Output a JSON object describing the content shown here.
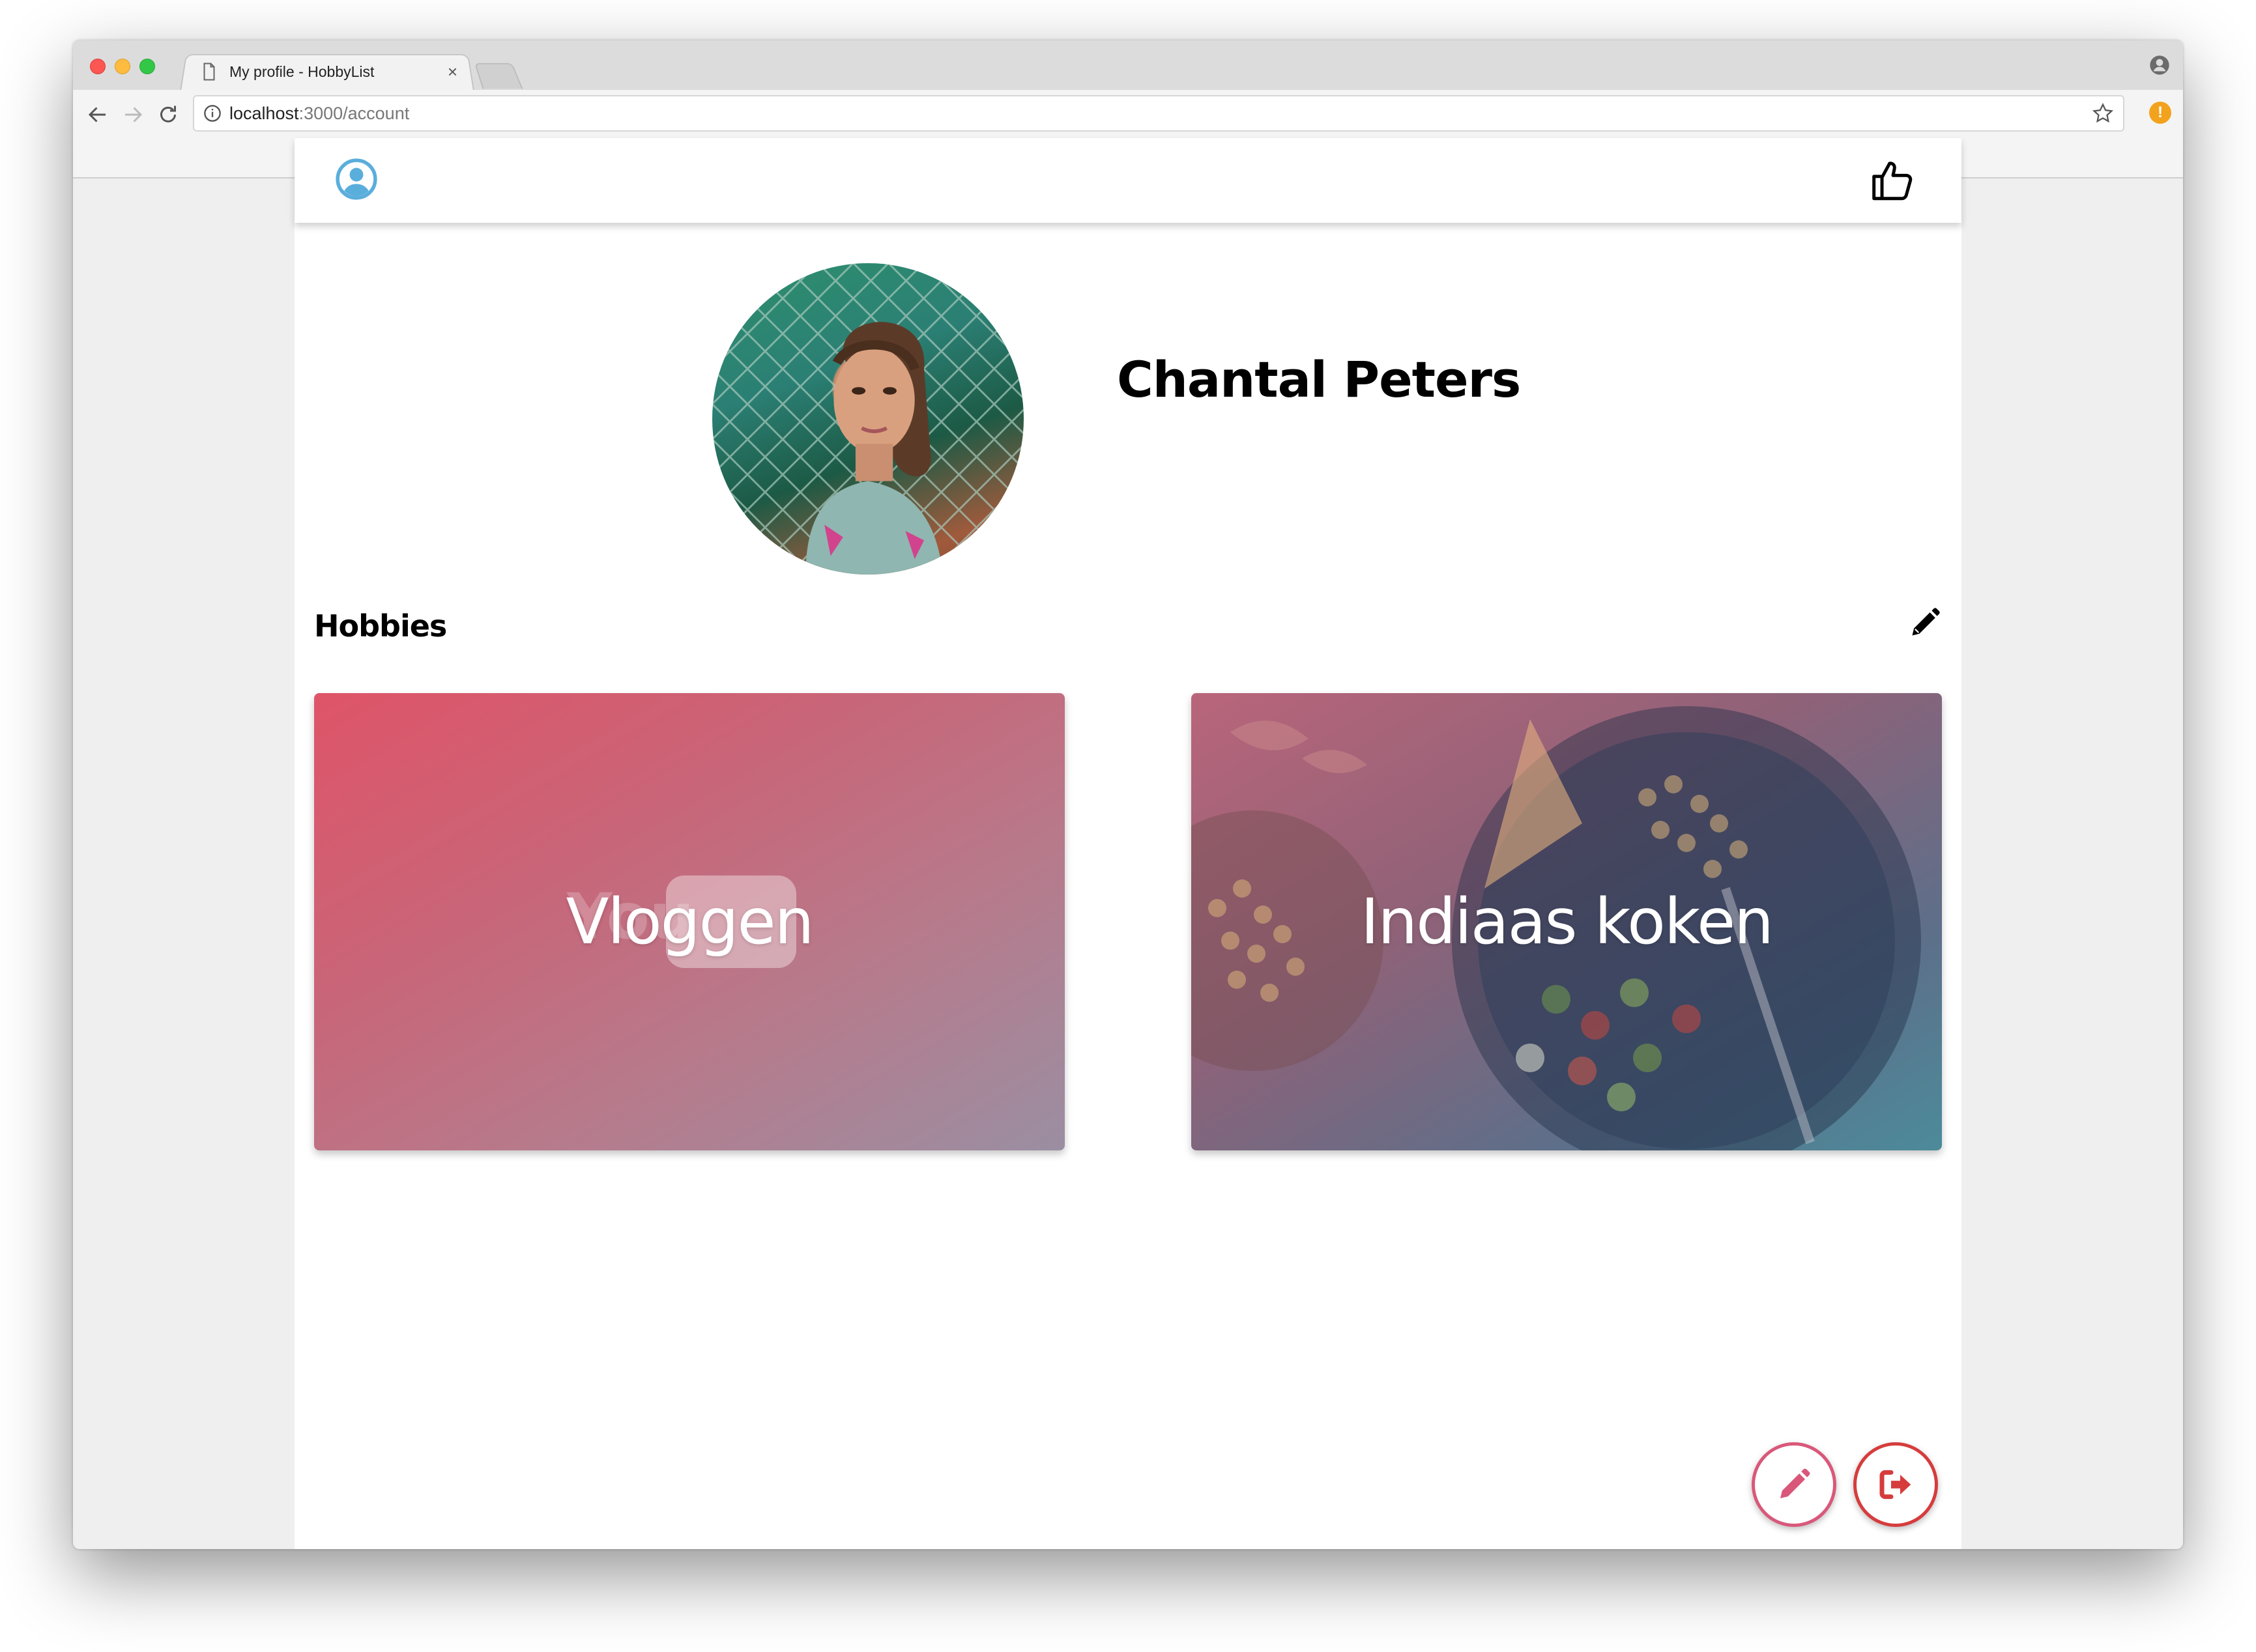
{
  "browser": {
    "tab_title": "My profile - HobbyList",
    "tab_close": "×",
    "url_host": "localhost",
    "url_path": ":3000/account",
    "extension_badge": "!"
  },
  "profile": {
    "name": "Chantal Peters"
  },
  "hobbies": {
    "heading": "Hobbies",
    "items": [
      {
        "label": "Vloggen"
      },
      {
        "label": "Indiaas koken"
      }
    ]
  },
  "colors": {
    "accent_pink": "#d9587a",
    "accent_red": "#d63c3c",
    "account_icon": "#5aaedc"
  },
  "icons": {
    "header_left": "account-circle-icon",
    "header_right": "thumbs-up-icon",
    "hobbies_edit": "pencil-icon",
    "fab_edit": "pencil-icon",
    "fab_logout": "sign-out-icon"
  }
}
